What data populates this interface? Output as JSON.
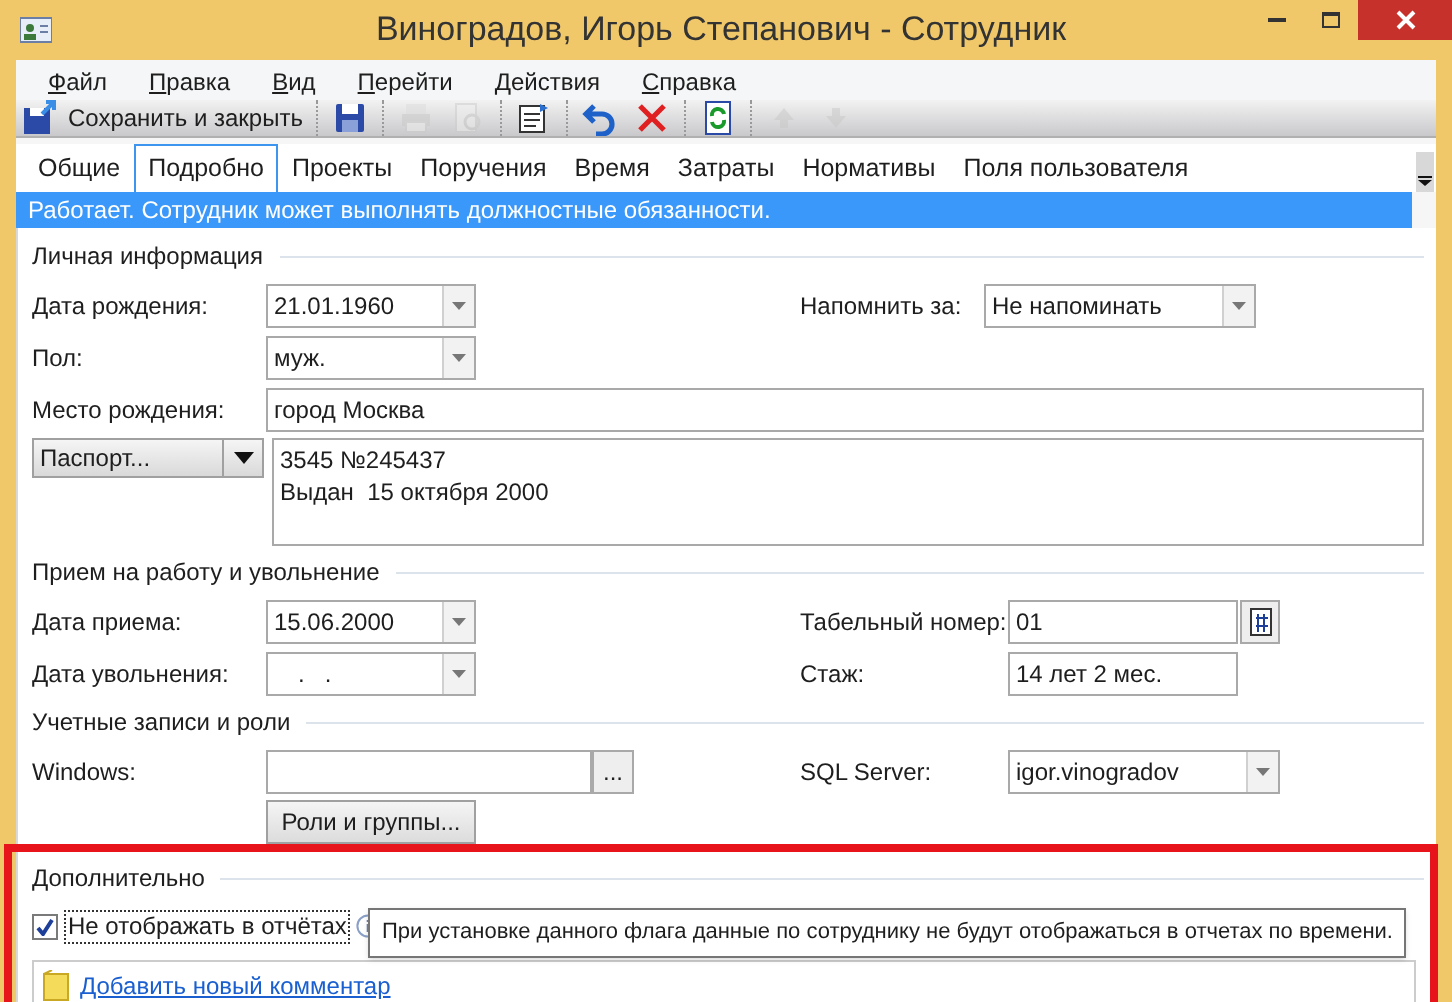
{
  "window": {
    "title": "Виноградов, Игорь Степанович - Сотрудник"
  },
  "menu": [
    "Файл",
    "Правка",
    "Вид",
    "Перейти",
    "Действия",
    "Справка"
  ],
  "toolbar": {
    "save_close": "Сохранить и закрыть",
    "buttons": [
      {
        "kind": "save",
        "disabled": false
      },
      {
        "kind": "print",
        "disabled": true
      },
      {
        "kind": "preview",
        "disabled": true
      },
      {
        "kind": "properties",
        "disabled": false
      },
      {
        "kind": "undo",
        "disabled": false
      },
      {
        "kind": "delete",
        "disabled": false
      },
      {
        "kind": "refresh",
        "disabled": false
      },
      {
        "kind": "up",
        "disabled": true
      },
      {
        "kind": "down",
        "disabled": true
      }
    ]
  },
  "tabs": [
    {
      "label": "Общие",
      "selected": false
    },
    {
      "label": "Подробно",
      "selected": true
    },
    {
      "label": "Проекты",
      "selected": false
    },
    {
      "label": "Поручения",
      "selected": false
    },
    {
      "label": "Время",
      "selected": false
    },
    {
      "label": "Затраты",
      "selected": false
    },
    {
      "label": "Нормативы",
      "selected": false
    },
    {
      "label": "Поля пользователя",
      "selected": false
    }
  ],
  "status_banner": "Работает. Сотрудник может выполнять должностные обязанности.",
  "personal": {
    "title": "Личная информация",
    "birth_date": {
      "label": "Дата рождения:",
      "value": "21.01.1960"
    },
    "remind": {
      "label": "Напомнить за:",
      "value": "Не напоминать"
    },
    "gender": {
      "label": "Пол:",
      "value": "муж."
    },
    "birthplace": {
      "label": "Место рождения:",
      "value": "город Москва"
    },
    "document": {
      "type": "Паспорт...",
      "lines": [
        "3545 №245437",
        "Выдан  15 октября 2000"
      ]
    }
  },
  "employment": {
    "title": "Прием на работу и увольнение",
    "hire_date": {
      "label": "Дата приема:",
      "value": "15.06.2000"
    },
    "personnel_number": {
      "label": "Табельный номер:",
      "value": "01"
    },
    "dismissal_date": {
      "label": "Дата увольнения:",
      "value": ".   ."
    },
    "tenure": {
      "label": "Стаж:",
      "value": "14 лет 2 мес."
    }
  },
  "accounts": {
    "title": "Учетные записи и роли",
    "windows": {
      "label": "Windows:",
      "browse": "..."
    },
    "sql_server": {
      "label": "SQL Server:",
      "value": "igor.vinogradov"
    },
    "roles_button": "Роли и группы..."
  },
  "additional": {
    "title": "Дополнительно",
    "hide_in_reports": {
      "label": "Не отображать в отчётах",
      "checked": true
    },
    "add_comment": "Добавить новый комментар",
    "tooltip": "При установке данного флага данные по сотруднику не будут отображаться в отчетах по времени."
  }
}
